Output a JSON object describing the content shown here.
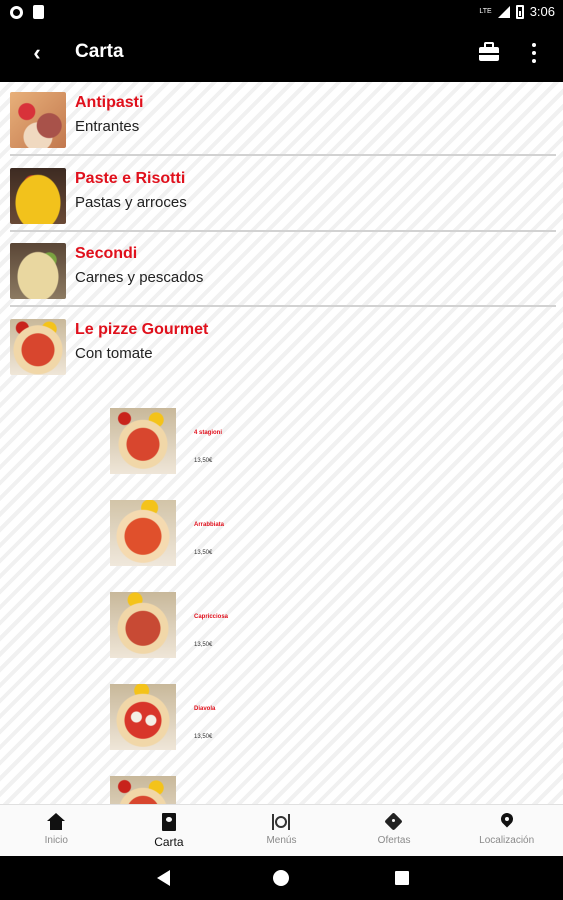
{
  "status_bar": {
    "lte": "LTE",
    "time": "3:06"
  },
  "app_bar": {
    "title": "Carta"
  },
  "categories": [
    {
      "title": "Antipasti",
      "subtitle": "Entrantes"
    },
    {
      "title": "Paste e Risotti",
      "subtitle": "Pastas y arroces"
    },
    {
      "title": "Secondi",
      "subtitle": "Carnes y pescados"
    },
    {
      "title": "Le pizze Gourmet",
      "subtitle": "Con tomate"
    }
  ],
  "pizzas": [
    {
      "name": "4 stagioni",
      "price": "13,50€"
    },
    {
      "name": "Arrabbiata",
      "price": "13,50€"
    },
    {
      "name": "Capricciosa",
      "price": "13,50€"
    },
    {
      "name": "Diavola",
      "price": "13,50€"
    }
  ],
  "bottom_nav": [
    {
      "label": "Inicio",
      "icon": "home-icon"
    },
    {
      "label": "Carta",
      "icon": "carta-icon",
      "active": true
    },
    {
      "label": "Menús",
      "icon": "menus-icon"
    },
    {
      "label": "Ofertas",
      "icon": "ofertas-icon"
    },
    {
      "label": "Localización",
      "icon": "location-icon"
    }
  ],
  "colors": {
    "accent": "#e0101c",
    "bar": "#000000"
  }
}
